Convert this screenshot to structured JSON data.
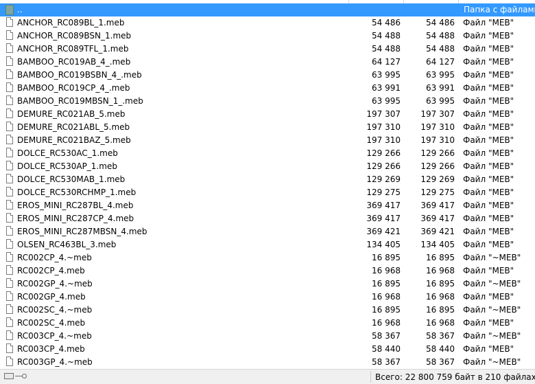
{
  "parent_row": {
    "name": "..",
    "type": "Папка с файлами"
  },
  "files": [
    {
      "name": "ANCHOR_RC089BL_1.meb",
      "size": "54 486",
      "packed": "54 486",
      "type": "Файл \"MEB\""
    },
    {
      "name": "ANCHOR_RC089BSN_1.meb",
      "size": "54 488",
      "packed": "54 488",
      "type": "Файл \"MEB\""
    },
    {
      "name": "ANCHOR_RC089TFL_1.meb",
      "size": "54 488",
      "packed": "54 488",
      "type": "Файл \"MEB\""
    },
    {
      "name": "BAMBOO_RC019AB_4_.meb",
      "size": "64 127",
      "packed": "64 127",
      "type": "Файл \"MEB\""
    },
    {
      "name": "BAMBOO_RC019BSBN_4_.meb",
      "size": "63 995",
      "packed": "63 995",
      "type": "Файл \"MEB\""
    },
    {
      "name": "BAMBOO_RC019CP_4_.meb",
      "size": "63 991",
      "packed": "63 991",
      "type": "Файл \"MEB\""
    },
    {
      "name": "BAMBOO_RC019MBSN_1_.meb",
      "size": "63 995",
      "packed": "63 995",
      "type": "Файл \"MEB\""
    },
    {
      "name": "DEMURE_RC021AB_5.meb",
      "size": "197 307",
      "packed": "197 307",
      "type": "Файл \"MEB\""
    },
    {
      "name": "DEMURE_RC021ABL_5.meb",
      "size": "197 310",
      "packed": "197 310",
      "type": "Файл \"MEB\""
    },
    {
      "name": "DEMURE_RC021BAZ_5.meb",
      "size": "197 310",
      "packed": "197 310",
      "type": "Файл \"MEB\""
    },
    {
      "name": "DOLCE_RC530AC_1.meb",
      "size": "129 266",
      "packed": "129 266",
      "type": "Файл \"MEB\""
    },
    {
      "name": "DOLCE_RC530AP_1.meb",
      "size": "129 266",
      "packed": "129 266",
      "type": "Файл \"MEB\""
    },
    {
      "name": "DOLCE_RC530MAB_1.meb",
      "size": "129 269",
      "packed": "129 269",
      "type": "Файл \"MEB\""
    },
    {
      "name": "DOLCE_RC530RCHMP_1.meb",
      "size": "129 275",
      "packed": "129 275",
      "type": "Файл \"MEB\""
    },
    {
      "name": "EROS_MINI_RC287BL_4.meb",
      "size": "369 417",
      "packed": "369 417",
      "type": "Файл \"MEB\""
    },
    {
      "name": "EROS_MINI_RC287CP_4.meb",
      "size": "369 417",
      "packed": "369 417",
      "type": "Файл \"MEB\""
    },
    {
      "name": "EROS_MINI_RC287MBSN_4.meb",
      "size": "369 421",
      "packed": "369 421",
      "type": "Файл \"MEB\""
    },
    {
      "name": "OLSEN_RC463BL_3.meb",
      "size": "134 405",
      "packed": "134 405",
      "type": "Файл \"MEB\""
    },
    {
      "name": "RC002CP_4.~meb",
      "size": "16 895",
      "packed": "16 895",
      "type": "Файл \"~MEB\""
    },
    {
      "name": "RC002CP_4.meb",
      "size": "16 968",
      "packed": "16 968",
      "type": "Файл \"MEB\""
    },
    {
      "name": "RC002GP_4.~meb",
      "size": "16 895",
      "packed": "16 895",
      "type": "Файл \"~MEB\""
    },
    {
      "name": "RC002GP_4.meb",
      "size": "16 968",
      "packed": "16 968",
      "type": "Файл \"MEB\""
    },
    {
      "name": "RC002SC_4.~meb",
      "size": "16 895",
      "packed": "16 895",
      "type": "Файл \"~MEB\""
    },
    {
      "name": "RC002SC_4.meb",
      "size": "16 968",
      "packed": "16 968",
      "type": "Файл \"MEB\""
    },
    {
      "name": "RC003CP_4.~meb",
      "size": "58 367",
      "packed": "58 367",
      "type": "Файл \"~MEB\""
    },
    {
      "name": "RC003CP_4.meb",
      "size": "58 440",
      "packed": "58 440",
      "type": "Файл \"MEB\""
    },
    {
      "name": "RC003GP_4.~meb",
      "size": "58 367",
      "packed": "58 367",
      "type": "Файл \"~MEB\""
    }
  ],
  "status": {
    "summary": "Всего: 22 800 759 байт в 210 файлах"
  },
  "icons": {
    "parent": "folder-up-icon",
    "file": "file-icon",
    "status_left": "lock-icon",
    "status_right": "key-icon"
  },
  "colors": {
    "selection": "#3399ff",
    "selection_text": "#ffffff",
    "status_bg": "#f0f0f0"
  }
}
